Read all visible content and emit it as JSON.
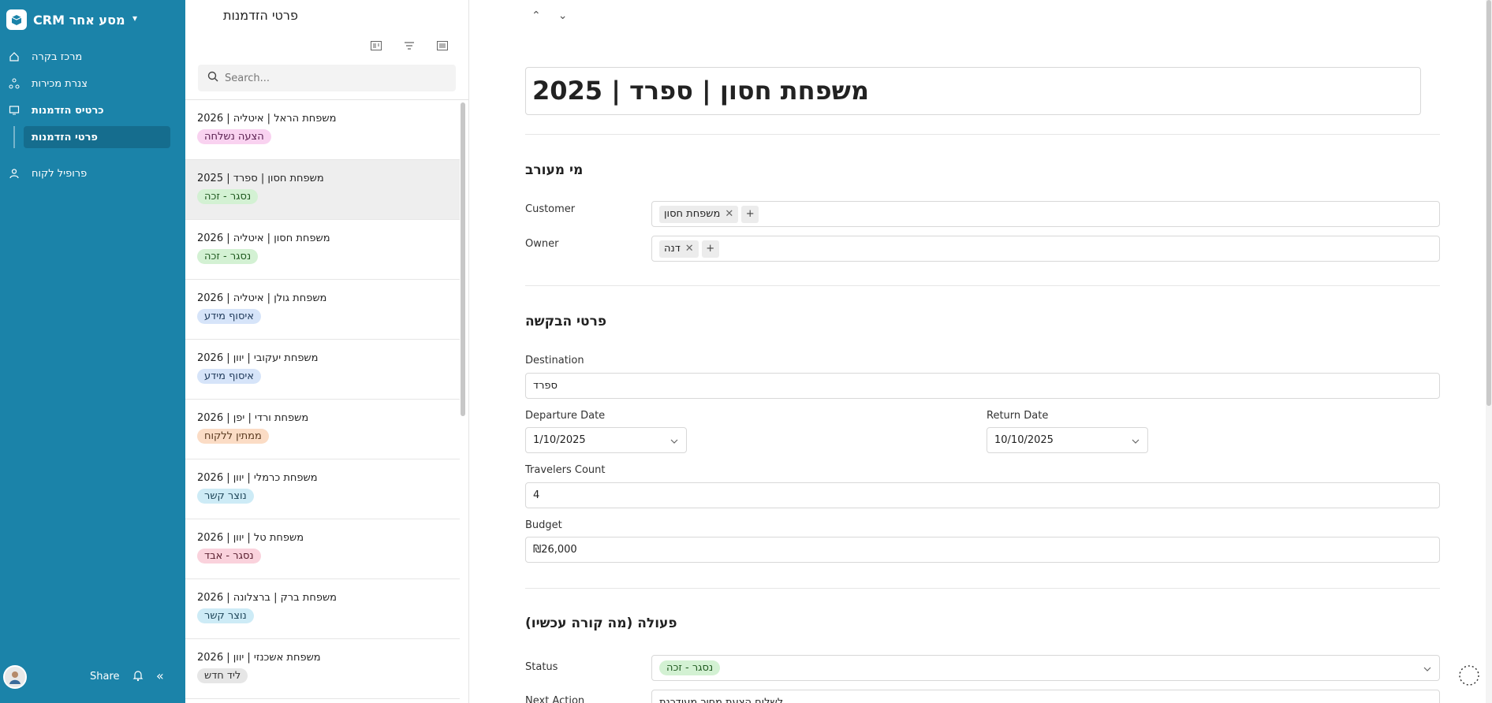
{
  "sidebar": {
    "app_title": "CRM מסע אחר",
    "items": [
      {
        "label": "מרכז בקרה",
        "icon": "home-icon"
      },
      {
        "label": "צנרת מכירות",
        "icon": "pipeline-icon"
      },
      {
        "label": "כרטיס הזדמנות",
        "icon": "monitor-icon"
      },
      {
        "label": "פרופיל לקוח",
        "icon": "person-icon"
      }
    ],
    "sub_item": "פרטי הזדמנות",
    "footer": {
      "share": "Share"
    }
  },
  "list_panel": {
    "title": "פרטי הזדמנות",
    "search_placeholder": "Search...",
    "rows": [
      {
        "name": "משפחת הראל | איטליה | 2026",
        "status": "הצעה נשלחה",
        "bg": "#f9d2f0",
        "fg": "#5a2050"
      },
      {
        "name": "משפחת חסון | ספרד | 2025",
        "status": "נסגר - זכה",
        "bg": "#d3f1d3",
        "fg": "#205a20"
      },
      {
        "name": "משפחת חסון | איטליה | 2026",
        "status": "נסגר - זכה",
        "bg": "#d3f1d3",
        "fg": "#205a20"
      },
      {
        "name": "משפחת גולן | איטליה | 2026",
        "status": "איסוף מידע",
        "bg": "#d6e4f9",
        "fg": "#203a5a"
      },
      {
        "name": "משפחת יעקובי | יוון | 2026",
        "status": "איסוף מידע",
        "bg": "#d6e4f9",
        "fg": "#203a5a"
      },
      {
        "name": "משפחת ורדי | יפן | 2026",
        "status": "ממתין ללקוח",
        "bg": "#fbdcc5",
        "fg": "#5a3a20"
      },
      {
        "name": "משפחת כרמלי | יוון | 2026",
        "status": "נוצר קשר",
        "bg": "#cdebf6",
        "fg": "#20475a"
      },
      {
        "name": "משפחת טל | יוון | 2026",
        "status": "נסגר - אבד",
        "bg": "#fad2dc",
        "fg": "#5a2030"
      },
      {
        "name": "משפחת ברק | ברצלונה | 2026",
        "status": "נוצר קשר",
        "bg": "#cdebf6",
        "fg": "#20475a"
      },
      {
        "name": "משפחת אשכנזי | יוון | 2026",
        "status": "ליד חדש",
        "bg": "#e6e6e6",
        "fg": "#333333"
      }
    ]
  },
  "main": {
    "title": "משפחת חסון | ספרד | 2025",
    "section_who": "מי מעורב",
    "customer_label": "Customer",
    "customer_chip": "משפחת חסון",
    "owner_label": "Owner",
    "owner_chip": "דנה",
    "section_request": "פרטי הבקשה",
    "destination_label": "Destination",
    "destination_value": "ספרד",
    "departure_label": "Departure Date",
    "departure_value": "1/10/2025",
    "return_label": "Return Date",
    "return_value": "10/10/2025",
    "travelers_label": "Travelers Count",
    "travelers_value": "4",
    "budget_label": "Budget",
    "budget_value": "₪26,000",
    "section_action": "פעולה (מה קורה עכשיו)",
    "status_label": "Status",
    "status_value": "נסגר - זכה",
    "next_action_label": "Next Action",
    "next_action_value": "לשלוח הצעת מחיר מעודכנת"
  },
  "colors": {
    "sidebar": "#1b83a9",
    "sidebar_selected": "#156d8e"
  }
}
